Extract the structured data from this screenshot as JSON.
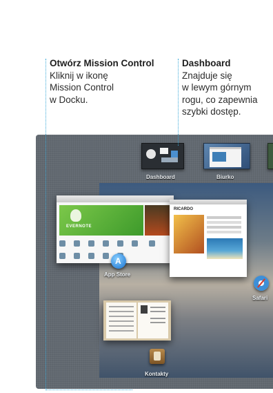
{
  "callouts": {
    "mission_control": {
      "title": "Otwórz Mission Control",
      "lines": [
        "Kliknij w ikonę",
        "Mission Control",
        "w Docku."
      ]
    },
    "dashboard": {
      "title": "Dashboard",
      "lines": [
        "Znajduje się",
        "w lewym górnym",
        "rogu, co zapewnia",
        "szybki dostęp."
      ]
    }
  },
  "spaces": {
    "dashboard_label": "Dashboard",
    "desktop_label": "Biurko"
  },
  "windows": {
    "appstore": {
      "label": "App Store",
      "banner_text": "EVERNOTE"
    },
    "safari": {
      "label": "Safari",
      "page_title": "RICARDO"
    },
    "contacts": {
      "label": "Kontakty"
    }
  },
  "colors": {
    "leader_line": "#38a8d8",
    "mission_control_bg": "#626971"
  },
  "icons": [
    "app-store-icon",
    "safari-icon",
    "contacts-icon"
  ]
}
